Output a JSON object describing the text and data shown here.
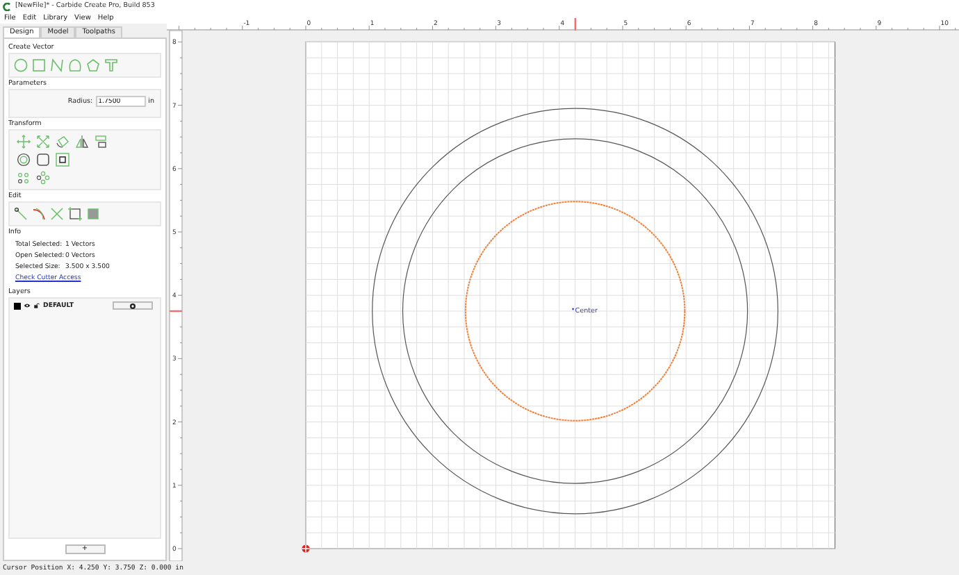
{
  "window": {
    "title": "[NewFile]* - Carbide Create Pro, Build 853"
  },
  "menu": [
    "File",
    "Edit",
    "Library",
    "View",
    "Help"
  ],
  "tabs": [
    {
      "label": "Design",
      "selected": true
    },
    {
      "label": "Model",
      "selected": false
    },
    {
      "label": "Toolpaths",
      "selected": false
    }
  ],
  "create_vector": {
    "title": "Create Vector"
  },
  "parameters": {
    "title": "Parameters",
    "radius_label": "Radius:",
    "radius_value": "1.7500",
    "unit": "in"
  },
  "transform": {
    "title": "Transform"
  },
  "edit": {
    "title": "Edit"
  },
  "info": {
    "title": "Info",
    "rows": [
      {
        "label": "Total Selected:",
        "value": "1 Vectors"
      },
      {
        "label": "Open Selected:",
        "value": "0 Vectors"
      },
      {
        "label": "Selected Size:",
        "value": "3.500 x 3.500"
      }
    ],
    "link": "Check Cutter Access"
  },
  "layers": {
    "title": "Layers",
    "items": [
      {
        "name": "DEFAULT",
        "color": "#000000"
      }
    ],
    "add_button": "+"
  },
  "rulers": {
    "x_labels": [
      "-1",
      "0",
      "1",
      "2",
      "3",
      "4",
      "5",
      "6",
      "7",
      "8",
      "9",
      "10"
    ],
    "y_labels": [
      "8",
      "7",
      "6",
      "5",
      "4",
      "3",
      "2",
      "1",
      "0"
    ]
  },
  "canvas": {
    "vectors": [
      {
        "kind": "circle",
        "selected": false
      },
      {
        "kind": "circle",
        "selected": false
      },
      {
        "kind": "circle",
        "selected": true
      }
    ],
    "center_label": "Center"
  },
  "status_bar": "Cursor Position X: 4.250 Y: 3.750 Z: 0.000 in"
}
